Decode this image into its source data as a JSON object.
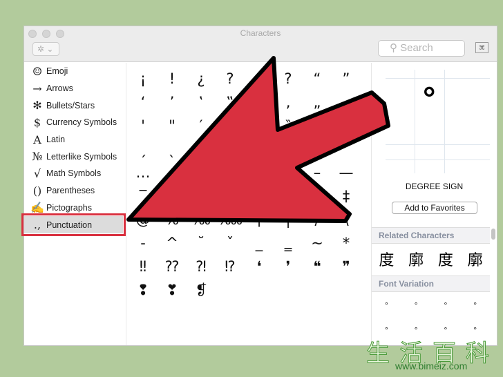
{
  "window": {
    "title": "Characters",
    "search_placeholder": "Search",
    "keyboard_icon_label": "⌘"
  },
  "sidebar": {
    "items": [
      {
        "icon": "☺",
        "label": "Emoji"
      },
      {
        "icon": "→",
        "label": "Arrows"
      },
      {
        "icon": "✻",
        "label": "Bullets/Stars"
      },
      {
        "icon": "$",
        "label": "Currency Symbols"
      },
      {
        "icon": "A",
        "label": "Latin"
      },
      {
        "icon": "№",
        "label": "Letterlike Symbols"
      },
      {
        "icon": "√",
        "label": "Math Symbols"
      },
      {
        "icon": "()",
        "label": "Parentheses"
      },
      {
        "icon": "✍",
        "label": "Pictographs"
      },
      {
        "icon": ".,",
        "label": "Punctuation",
        "selected": true
      }
    ]
  },
  "grid": {
    "characters": [
      "¡",
      "!",
      "¿",
      "?",
      "",
      "?",
      "“",
      "”",
      "‘",
      "’",
      "‛",
      "‟",
      "",
      "‚",
      "„",
      "",
      "'",
      "\"",
      "′",
      "",
      "",
      "‶",
      "",
      "",
      "ˏ",
      "ˎ",
      "",
      "",
      "",
      "",
      "",
      "",
      "…",
      "",
      "",
      "",
      "",
      "",
      "–",
      "—",
      "‾",
      "",
      "",
      "",
      "",
      "",
      "",
      "‡",
      "@",
      "%",
      "‰",
      "‱",
      "¦",
      "|",
      "/",
      "\\",
      "‐",
      "^",
      "˘",
      "ˇ",
      "_",
      "‗",
      "~",
      "*",
      "‼",
      "⁇",
      "⁈",
      "⁉",
      "❛",
      "❜",
      "❝",
      "❞",
      "❢",
      "❣",
      "❡"
    ]
  },
  "detail": {
    "glyph": "°",
    "name": "DEGREE SIGN",
    "add_favorites": "Add to Favorites",
    "related_title": "Related Characters",
    "related": [
      "度",
      "廓",
      "度",
      "廓"
    ],
    "font_variation_title": "Font Variation",
    "variations": [
      "°",
      "°",
      "°",
      "°",
      "°",
      "°",
      "°",
      "°"
    ]
  },
  "annotation": {
    "arrow_color": "#d9303f",
    "highlight_color": "#d9303f"
  },
  "watermark": {
    "text": "生活百科",
    "url": "www.bimeiz.com"
  }
}
